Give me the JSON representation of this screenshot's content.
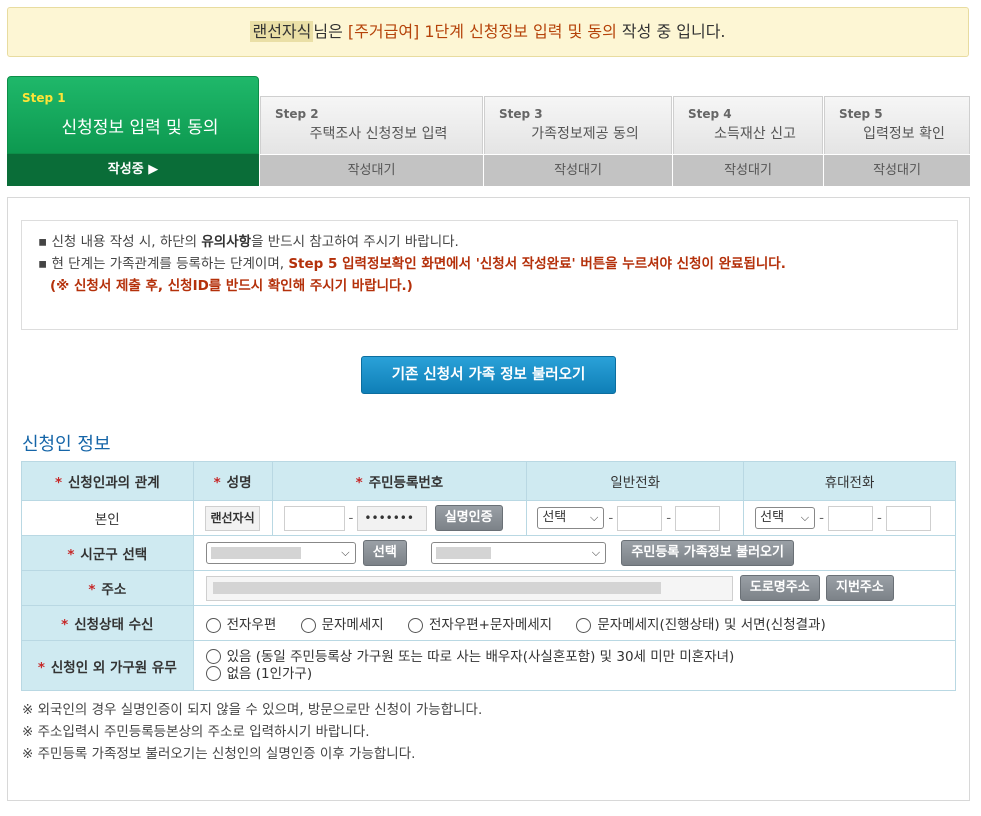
{
  "banner": {
    "username": "랜선자식",
    "suffix": "님은",
    "highlight": "[주거급여] 1단계 신청정보 입력 및 동의",
    "tail": "작성 중 입니다."
  },
  "steps": [
    {
      "num": "Step 1",
      "title": "신청정보 입력 및 동의",
      "status": "작성중 ▶"
    },
    {
      "num": "Step 2",
      "title": "주택조사 신청정보 입력",
      "status": "작성대기"
    },
    {
      "num": "Step 3",
      "title": "가족정보제공 동의",
      "status": "작성대기"
    },
    {
      "num": "Step 4",
      "title": "소득재산 신고",
      "status": "작성대기"
    },
    {
      "num": "Step 5",
      "title": "입력정보 확인",
      "status": "작성대기"
    }
  ],
  "notice": {
    "line1_a": "▪ 신청 내용 작성 시, 하단의 ",
    "line1_b": "유의사항",
    "line1_c": "을 반드시 참고하여 주시기 바랍니다.",
    "line2_a": "▪ 현 단계는 가족관계를 등록하는 단계이며, ",
    "line2_b": "Step 5 입력정보확인 화면에서 '신청서 작성완료' 버튼을 누르셔야 신청이 완료됩니다.",
    "line3": "(※ 신청서 제출 후, 신청ID를 반드시 확인해 주시기 바랍니다.)"
  },
  "load_button": "기존 신청서 가족 정보 불러오기",
  "section_title": "신청인 정보",
  "table": {
    "headers": [
      "신청인과의 관계",
      "성명",
      "주민등록번호",
      "일반전화",
      "휴대전화"
    ],
    "row1": {
      "relation": "본인",
      "name": "랜선자식",
      "rrn_back": "•••••••",
      "verify_btn": "실명인증",
      "phone_select": "선택",
      "mobile_select": "선택"
    },
    "region": {
      "label": "시군구 선택",
      "select_btn": "선택",
      "load_family_btn": "주민등록 가족정보 불러오기"
    },
    "address": {
      "label": "주소",
      "road_btn": "도로명주소",
      "lot_btn": "지번주소"
    },
    "status_receive": {
      "label": "신청상태 수신",
      "options": [
        "전자우편",
        "문자메세지",
        "전자우편+문자메세지",
        "문자메세지(진행상태) 및 서면(신청결과)"
      ]
    },
    "household": {
      "label": "신청인 외 가구원 유무",
      "opt_yes": "있음 (동일 주민등록상 가구원 또는 따로 사는 배우자(사실혼포함) 및 30세 미만 미혼자녀)",
      "opt_no": "없음 (1인가구)"
    }
  },
  "footnotes": [
    "※ 외국인의 경우 실명인증이 되지 않을 수 있으며, 방문으로만 신청이 가능합니다.",
    "※ 주소입력시 주민등록등본상의 주소로 입력하시기 바랍니다.",
    "※ 주민등록 가족정보 불러오기는 신청인의 실명인증 이후 가능합니다."
  ],
  "colors": {
    "step_active": "#0d9950",
    "step_active_foot": "#0a6d38",
    "table_header_bg": "#cfeaf1",
    "primary_button": "#0f7fb7",
    "highlight_text": "#b5430a"
  }
}
